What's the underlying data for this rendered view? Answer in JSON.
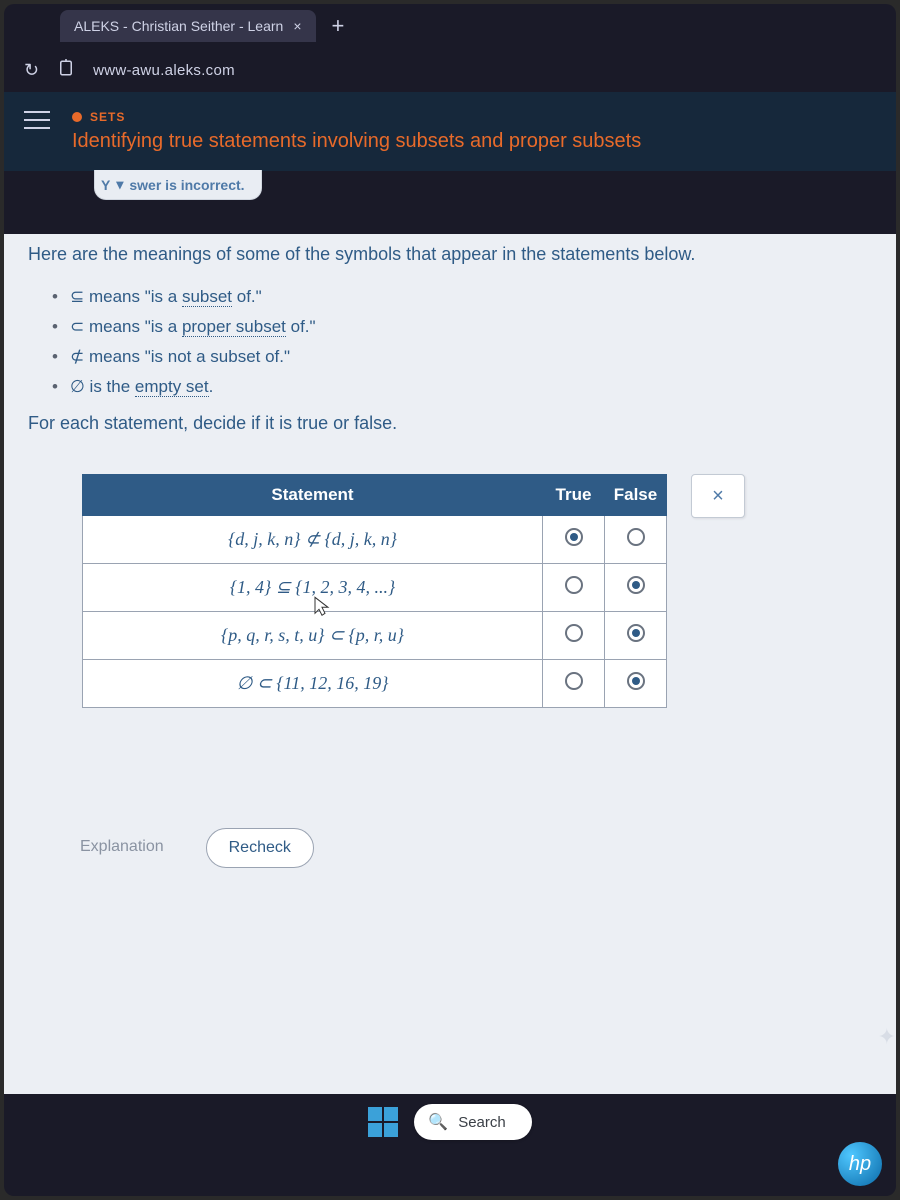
{
  "browser": {
    "tab_title": "ALEKS - Christian Seither - Learn",
    "url": "www-awu.aleks.com"
  },
  "header": {
    "category": "SETS",
    "title": "Identifying true statements involving subsets and proper subsets"
  },
  "feedback": {
    "prefix": "Y",
    "text": "swer is incorrect."
  },
  "intro": "Here are the meanings of some of the symbols that appear in the statements below.",
  "bullets": [
    {
      "sym": "⊆",
      "before": " means \"is a ",
      "link": "subset",
      "after": " of.\""
    },
    {
      "sym": "⊂",
      "before": " means \"is a ",
      "link": "proper subset",
      "after": " of.\""
    },
    {
      "sym": "⊄",
      "before": " means \"is not a subset of.\"",
      "link": "",
      "after": ""
    },
    {
      "sym": "∅",
      "before": " is the ",
      "link": "empty set",
      "after": "."
    }
  ],
  "instruction": "For each statement, decide if it is true or false.",
  "table": {
    "head_statement": "Statement",
    "head_true": "True",
    "head_false": "False",
    "rows": [
      {
        "stmt": "{d, j, k, n} ⊄ {d, j, k, n}",
        "selected": "true"
      },
      {
        "stmt": "{1, 4} ⊆ {1, 2, 3, 4, ...}",
        "selected": "false"
      },
      {
        "stmt": "{p, q, r, s, t, u} ⊂ {p, r, u}",
        "selected": "false"
      },
      {
        "stmt": "∅ ⊂ {11, 12, 16, 19}",
        "selected": "false"
      }
    ]
  },
  "buttons": {
    "explanation": "Explanation",
    "recheck": "Recheck"
  },
  "taskbar": {
    "search": "Search"
  },
  "logo": "hp"
}
